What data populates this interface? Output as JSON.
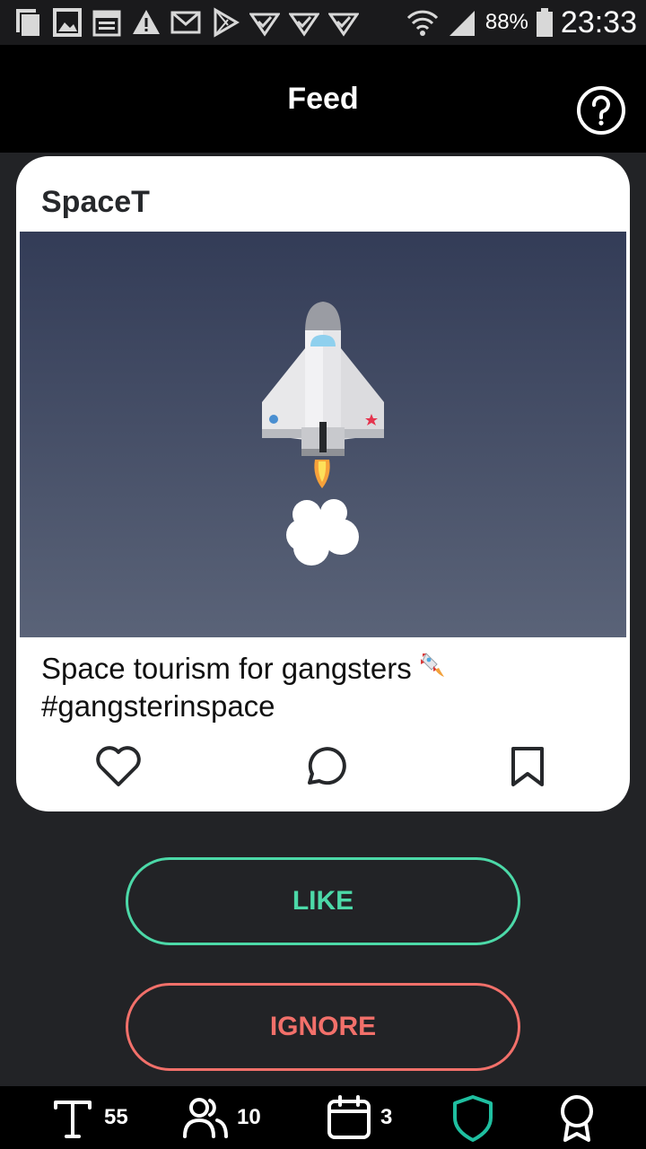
{
  "status_bar": {
    "battery": "88%",
    "time": "23:33",
    "left_icons": [
      "copy-icon",
      "image-icon",
      "calendar-icon",
      "warning-icon",
      "gmail-icon",
      "play-store-icon",
      "check-icon",
      "check-icon",
      "check-icon"
    ],
    "right_icons": [
      "wifi-icon",
      "signal-icon",
      "battery-icon"
    ]
  },
  "header": {
    "title": "Feed",
    "help_icon": "help-circle-icon"
  },
  "post": {
    "author": "SpaceT",
    "caption_line1": "Space tourism for gangsters",
    "caption_line2": "#gangsterinspace",
    "image": "rocket-launch-illustration",
    "actions": [
      "heart-icon",
      "comment-icon",
      "bookmark-icon"
    ]
  },
  "buttons": {
    "like": "LIKE",
    "ignore": "IGNORE",
    "like_color": "#4cd9a8",
    "ignore_color": "#f2706a"
  },
  "bottom_nav": {
    "text_count": "55",
    "people_count": "10",
    "calendar_count": "3",
    "items": [
      "text-icon",
      "people-icon",
      "calendar-icon",
      "shield-icon",
      "award-icon"
    ],
    "active_color": "#1fbfa0"
  }
}
